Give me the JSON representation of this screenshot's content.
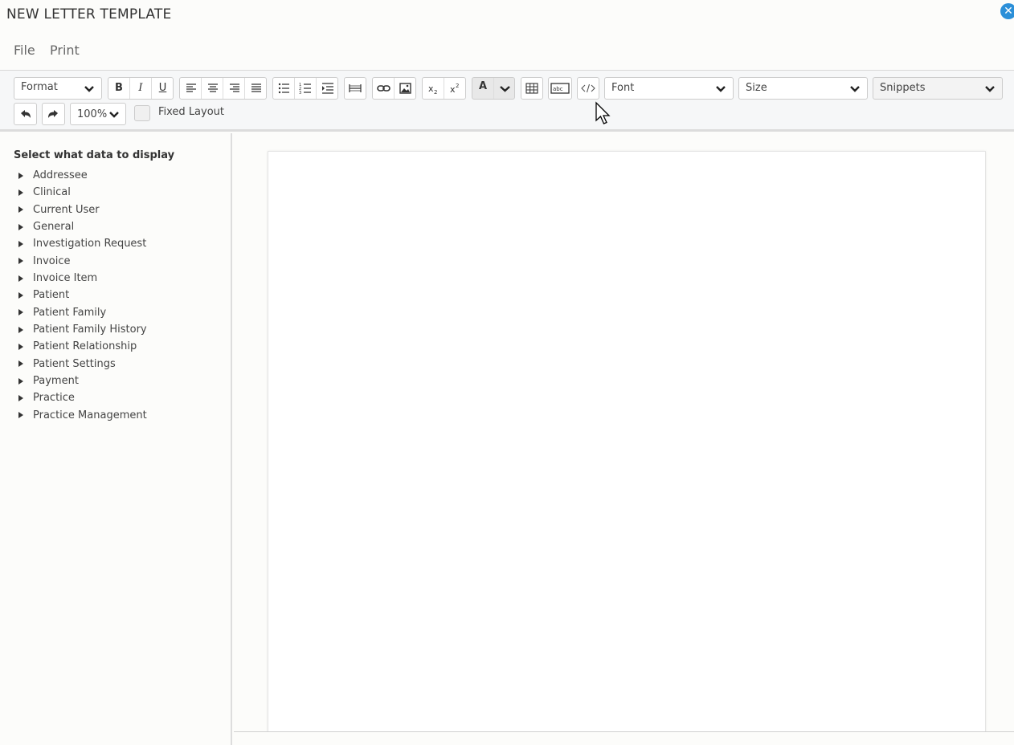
{
  "window": {
    "title": "NEW LETTER TEMPLATE",
    "close_label": "✕"
  },
  "menu": {
    "file": "File",
    "print": "Print"
  },
  "toolbar": {
    "format_label": "Format",
    "bold": "B",
    "italic": "I",
    "underline": "U",
    "font_color_label": "A",
    "font_label": "Font",
    "size_label": "Size",
    "snippets_label": "Snippets",
    "zoom_label": "100%",
    "fixed_layout_label": "Fixed Layout",
    "fixed_layout_checked": false
  },
  "sidebar": {
    "heading": "Select what data to display",
    "items": [
      "Addressee",
      "Clinical",
      "Current User",
      "General",
      "Investigation Request",
      "Invoice",
      "Invoice Item",
      "Patient",
      "Patient Family",
      "Patient Family History",
      "Patient Relationship",
      "Patient Settings",
      "Payment",
      "Practice",
      "Practice Management"
    ]
  },
  "colors": {
    "accent": "#2b8fd8"
  }
}
